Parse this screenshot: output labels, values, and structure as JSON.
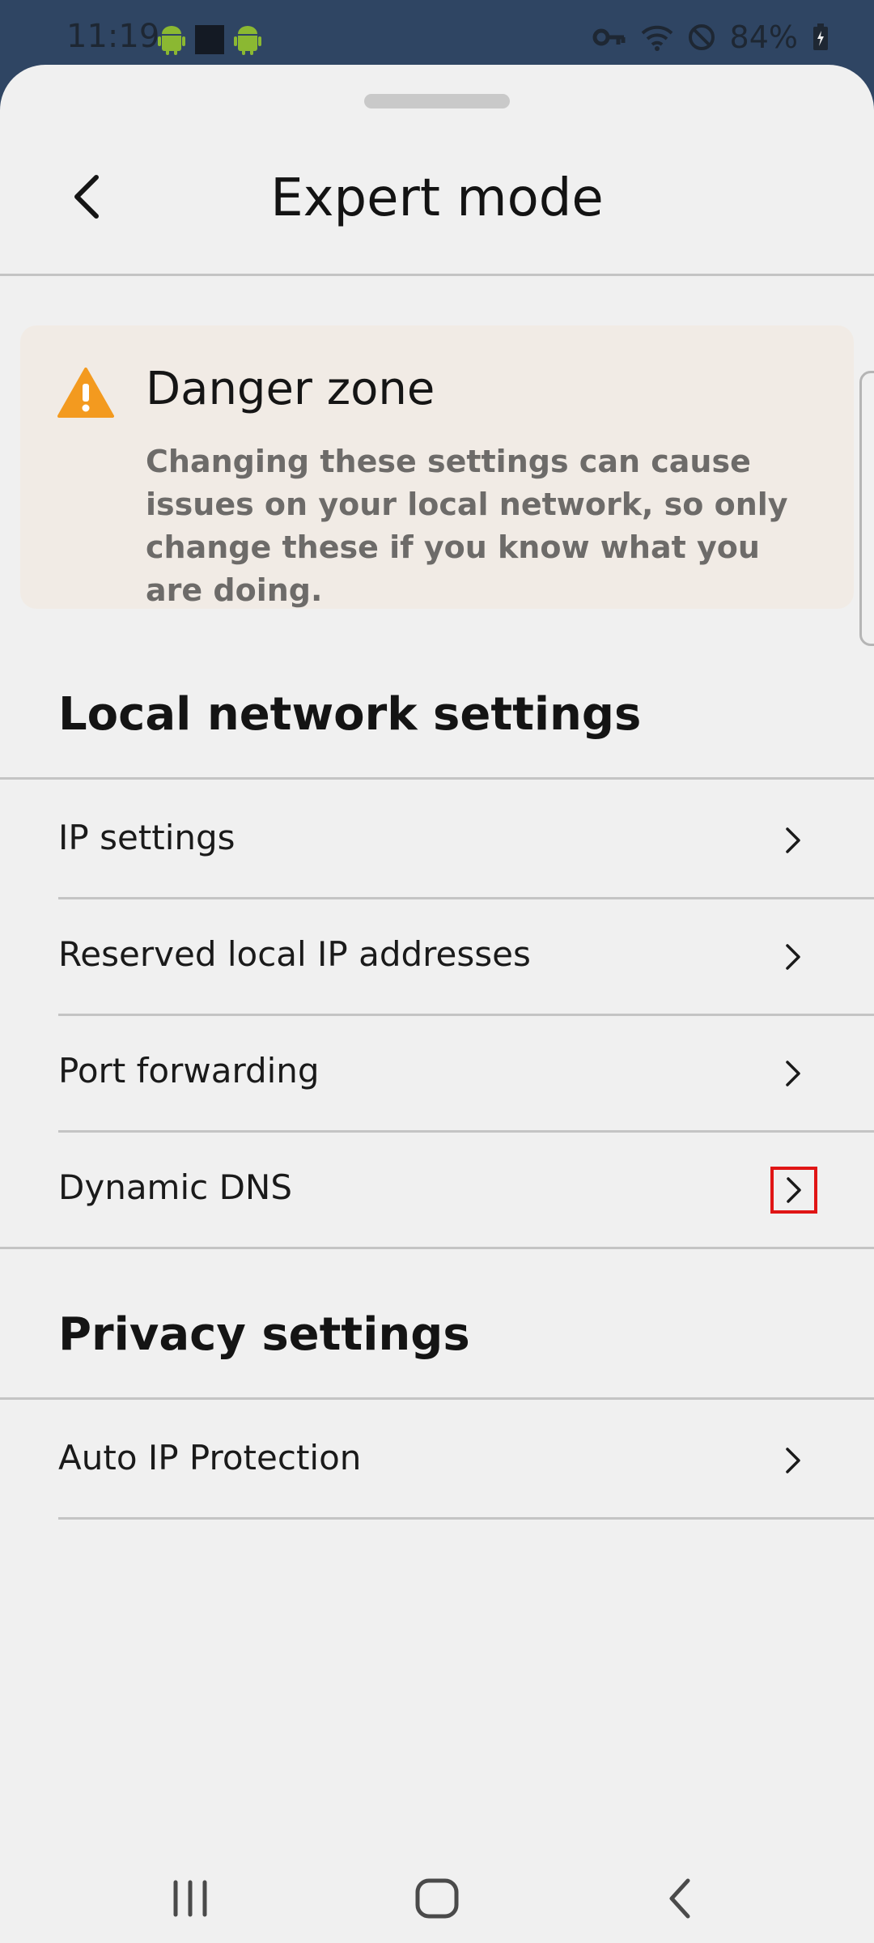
{
  "status_bar": {
    "time": "11:19",
    "battery": "84%",
    "icons": [
      "android-icon",
      "android-icon",
      "vpn-key-icon",
      "wifi-icon",
      "do-not-disturb-icon",
      "battery-charging-icon"
    ]
  },
  "header": {
    "title": "Expert mode",
    "back_icon": "chevron-left-icon"
  },
  "danger": {
    "title": "Danger zone",
    "text": "Changing these settings can cause issues on your local network, so only change these if you know what you are doing.",
    "icon": "warning-icon",
    "accent": "#f39a1f"
  },
  "sections": {
    "local": {
      "title": "Local network settings",
      "items": [
        {
          "label": "IP settings"
        },
        {
          "label": "Reserved local IP addresses"
        },
        {
          "label": "Port forwarding"
        },
        {
          "label": "Dynamic DNS"
        }
      ]
    },
    "privacy": {
      "title": "Privacy settings",
      "items": [
        {
          "label": "Auto IP Protection"
        }
      ]
    }
  },
  "highlight_color": "#e01515"
}
